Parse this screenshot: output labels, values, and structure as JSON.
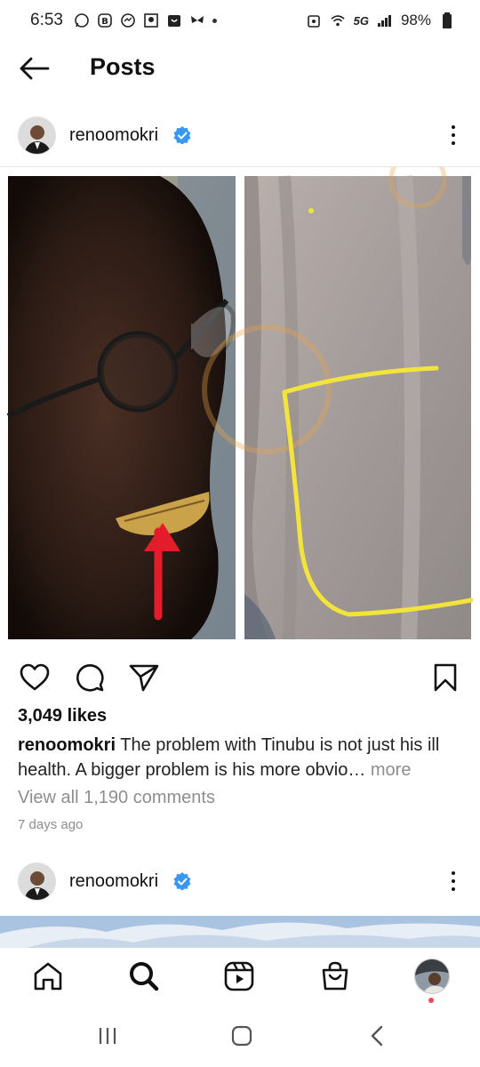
{
  "status_bar": {
    "time": "6:53",
    "network": "5G",
    "battery": "98%",
    "icons": [
      "whatsapp-icon",
      "messenger-icon",
      "gallery-icon",
      "shop-icon",
      "butterfly-icon",
      "alarm-icon",
      "wifi-icon",
      "signal-icon",
      "battery-icon"
    ]
  },
  "header": {
    "title": "Posts"
  },
  "post": {
    "username": "renoomokri",
    "likes": "3,049 likes",
    "caption_user": "renoomokri",
    "caption_text": " The problem with Tinubu is not just his ill health. A bigger problem is his more obvio",
    "caption_ellipsis": "… ",
    "caption_more": "more",
    "view_comments": "View all 1,190 comments",
    "time_ago": "7 days ago"
  },
  "next_post": {
    "username": "renoomokri"
  },
  "nav": {
    "items": [
      "home-icon",
      "search-icon",
      "reels-icon",
      "shop-icon",
      "profile"
    ]
  },
  "colors": {
    "verified_blue": "#3897f0",
    "notification_red": "#ed4956",
    "muted_text": "#8e8e8e",
    "highlight_yellow": "#f2e43a",
    "arrow_red": "#e41b2b"
  }
}
